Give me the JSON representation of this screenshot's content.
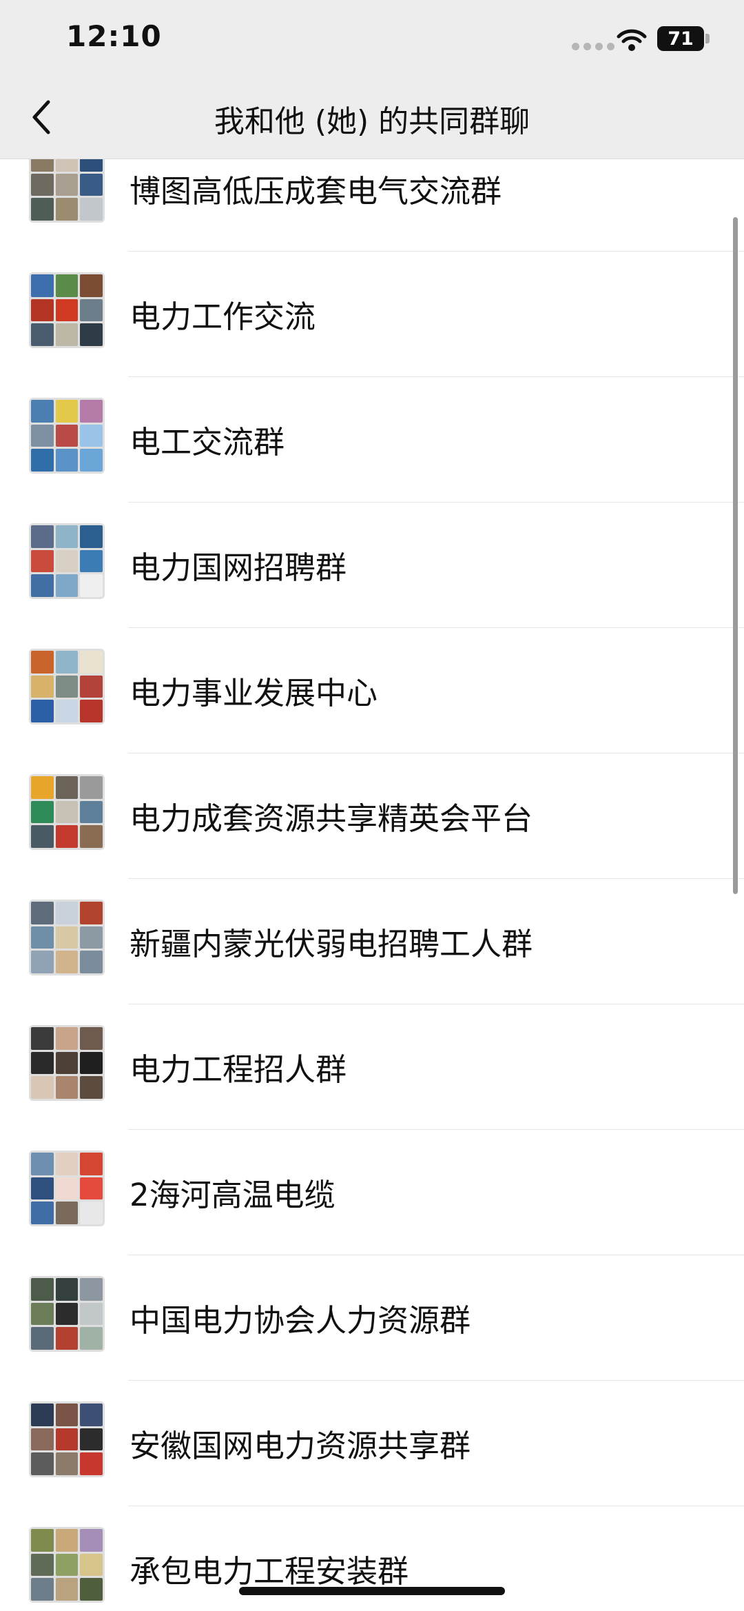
{
  "status_bar": {
    "time": "12:10",
    "battery": "71",
    "signal_icon": "signal-dots-icon",
    "wifi_icon": "wifi-icon"
  },
  "nav": {
    "title": "我和他 (她) 的共同群聊",
    "back_icon": "chevron-left-icon"
  },
  "groups": [
    {
      "name": "博图高低压成套电气交流群",
      "colors": [
        "#8b7a63",
        "#cfc4b5",
        "#2e4f7a",
        "#6f6a60",
        "#a99f90",
        "#3a5b86",
        "#4e5d55",
        "#9b8c70",
        "#c2c7cc"
      ]
    },
    {
      "name": "电力工作交流",
      "colors": [
        "#3d6fae",
        "#5a8b48",
        "#7b4d34",
        "#b43524",
        "#d03a22",
        "#6c7e8a",
        "#4a5c70",
        "#bdb7a6",
        "#2f3b46"
      ]
    },
    {
      "name": "电工交流群",
      "colors": [
        "#4b7fb2",
        "#e3c84a",
        "#b47aa8",
        "#7c8fa3",
        "#b94a45",
        "#9ac3e8",
        "#2f6ea8",
        "#5b93c9",
        "#6aa7d8"
      ]
    },
    {
      "name": "电力国网招聘群",
      "colors": [
        "#5b6c8a",
        "#8fb3c7",
        "#2a5f8f",
        "#c94b3b",
        "#d8d0c4",
        "#3c7cb5",
        "#416ea3",
        "#7fa7c9",
        "#efefef"
      ]
    },
    {
      "name": "电力事业发展中心",
      "colors": [
        "#c9642c",
        "#8fb5c8",
        "#e8e2cf",
        "#d8b26a",
        "#7e8c86",
        "#b3423a",
        "#2c5fa6",
        "#c9d6e3",
        "#b7342b"
      ]
    },
    {
      "name": "电力成套资源共享精英会平台",
      "colors": [
        "#e7a52a",
        "#6c6358",
        "#9a9a9a",
        "#2e8b57",
        "#c7c2b5",
        "#5d7f99",
        "#4a5a64",
        "#c43a2e",
        "#8a6c52"
      ]
    },
    {
      "name": "新疆内蒙光伏弱电招聘工人群",
      "colors": [
        "#5d6b7a",
        "#c9d2da",
        "#b2442f",
        "#6f8fa8",
        "#d8c9a4",
        "#8b9aa3",
        "#8fa3b4",
        "#d2b48c",
        "#7b8d9c"
      ]
    },
    {
      "name": "电力工程招人群",
      "colors": [
        "#3b3b3b",
        "#c8a58a",
        "#6e5b4d",
        "#2a2a2a",
        "#4e4036",
        "#1f1f1f",
        "#d9c6b5",
        "#a8856c",
        "#5c4b3f"
      ]
    },
    {
      "name": "2海河高温电缆",
      "colors": [
        "#6f8fb0",
        "#e2cfc2",
        "#d44532",
        "#2f4f7f",
        "#f0d9d0",
        "#e64a3c",
        "#3e6ea5",
        "#7a6a5c",
        "#e8e8e8"
      ]
    },
    {
      "name": "中国电力协会人力资源群",
      "colors": [
        "#4d5b4a",
        "#33403f",
        "#8d97a1",
        "#6b7d58",
        "#2c2c2c",
        "#c2c7c9",
        "#5a6a78",
        "#b4412f",
        "#9fb2a5"
      ]
    },
    {
      "name": "安徽国网电力资源共享群",
      "colors": [
        "#2e3b55",
        "#7a5446",
        "#3d4f74",
        "#8a6a5a",
        "#b53a2b",
        "#2c2c2c",
        "#5c5c5c",
        "#8c7b6b",
        "#c8372d"
      ]
    },
    {
      "name": "承包电力工程安装群",
      "colors": [
        "#7d8c4d",
        "#c9a87a",
        "#a58fb9",
        "#5f6b56",
        "#8fa063",
        "#d6c48a",
        "#6e7d8a",
        "#b9a27e",
        "#4f5e3c"
      ]
    }
  ]
}
